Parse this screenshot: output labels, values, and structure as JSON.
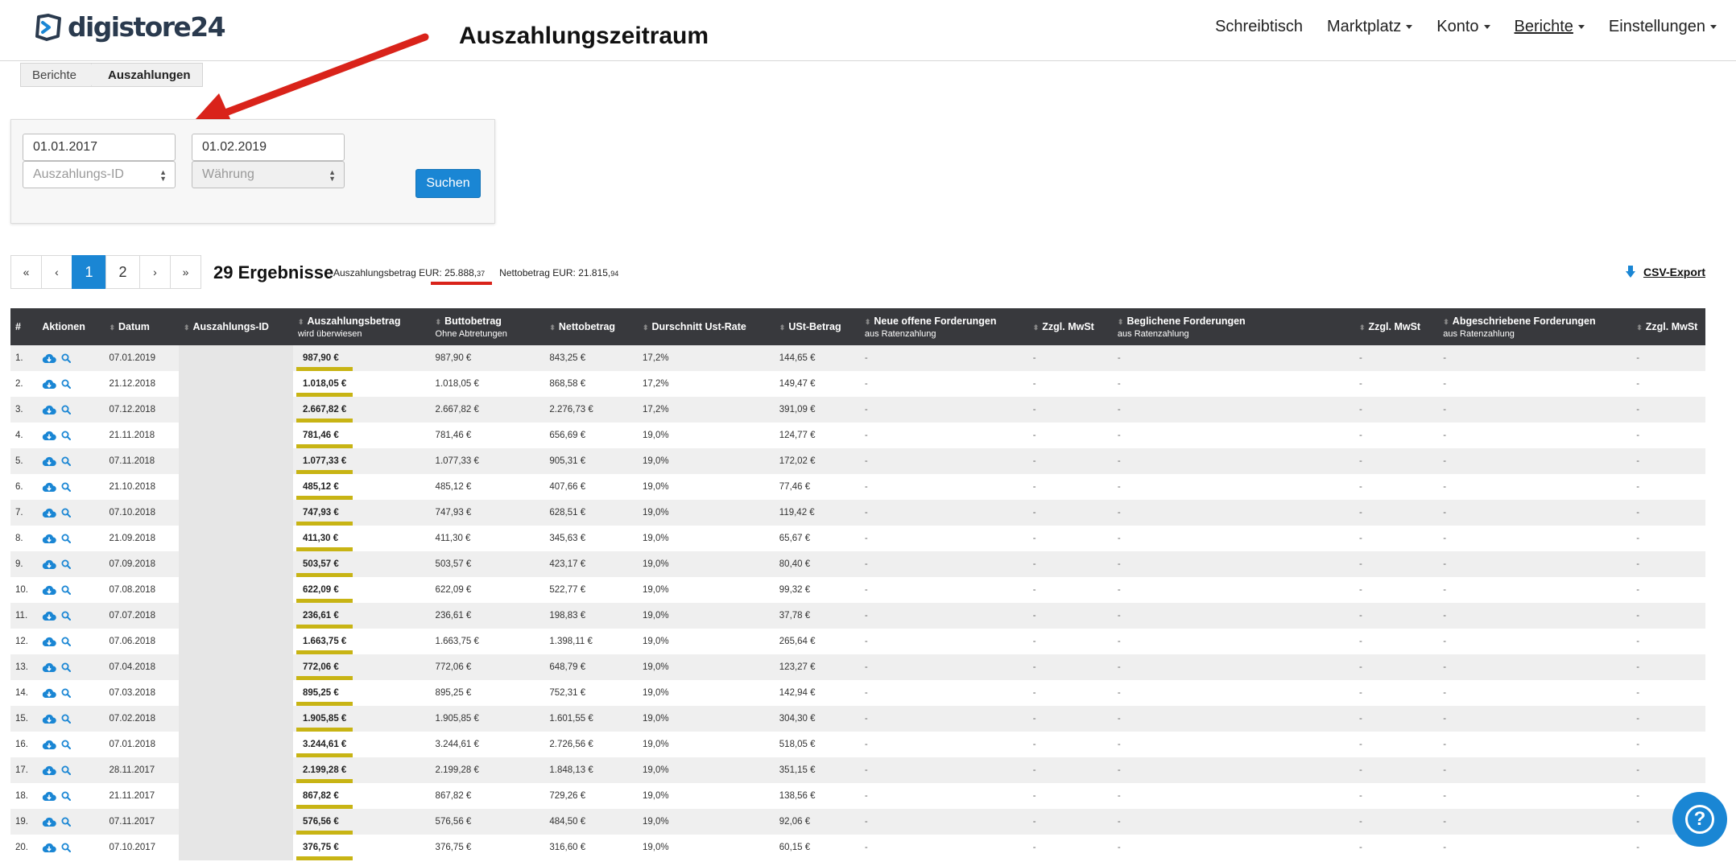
{
  "brand": {
    "name": "digistore24",
    "color": "#2a3a4e"
  },
  "nav": {
    "items": [
      {
        "label": "Schreibtisch"
      },
      {
        "label": "Marktplatz"
      },
      {
        "label": "Konto"
      },
      {
        "label": "Berichte",
        "active": true
      },
      {
        "label": "Einstellungen"
      }
    ]
  },
  "annotation": {
    "title": "Auszahlungszeitraum",
    "arrow_color": "#d9231a"
  },
  "breadcrumb": {
    "parent": "Berichte",
    "current": "Auszahlungen"
  },
  "filter": {
    "date_from": "01.01.2017",
    "date_to": "01.02.2019",
    "payout_id_placeholder": "Auszahlungs-ID",
    "currency_placeholder": "Währung",
    "search_label": "Suchen"
  },
  "pagination": {
    "first": "«",
    "prev": "‹",
    "pages": [
      "1",
      "2"
    ],
    "current": "1",
    "next": "›",
    "last": "»"
  },
  "summary": {
    "results": "29 Ergebnisse",
    "payout_label": "Auszahlungsbetrag EUR:",
    "payout_main": "25.888,",
    "payout_cents": "37",
    "net_label": "Nettobetrag EUR:",
    "net_main": "21.815,",
    "net_cents": "94",
    "csv_label": "CSV-Export"
  },
  "table": {
    "headers": [
      {
        "label": "#",
        "sort": false
      },
      {
        "label": "Aktionen",
        "sort": false
      },
      {
        "label": "Datum",
        "sort": true
      },
      {
        "label": "Auszahlungs-ID",
        "sort": true
      },
      {
        "label": "Auszahlungsbetrag",
        "sub": "wird überwiesen",
        "sort": true
      },
      {
        "label": "Buttobetrag",
        "sub": "Ohne Abtretungen",
        "sort": true
      },
      {
        "label": "Nettobetrag",
        "sort": true
      },
      {
        "label": "Durschnitt Ust-Rate",
        "sort": true
      },
      {
        "label": "USt-Betrag",
        "sort": true
      },
      {
        "label": "Neue offene Forderungen",
        "sub": "aus Ratenzahlung",
        "sort": true
      },
      {
        "label": "Zzgl. MwSt",
        "sort": true
      },
      {
        "label": "Beglichene Forderungen",
        "sub": "aus Ratenzahlung",
        "sort": true
      },
      {
        "label": "Zzgl. MwSt",
        "sort": true
      },
      {
        "label": "Abgeschriebene Forderungen",
        "sub": "aus Ratenzahlung",
        "sort": true
      },
      {
        "label": "Zzgl. MwSt",
        "sort": true
      }
    ],
    "rows": [
      [
        "1.",
        "07.01.2019",
        "987,90 €",
        "987,90 €",
        "843,25 €",
        "17,2%",
        "144,65 €"
      ],
      [
        "2.",
        "21.12.2018",
        "1.018,05 €",
        "1.018,05 €",
        "868,58 €",
        "17,2%",
        "149,47 €"
      ],
      [
        "3.",
        "07.12.2018",
        "2.667,82 €",
        "2.667,82 €",
        "2.276,73 €",
        "17,2%",
        "391,09 €"
      ],
      [
        "4.",
        "21.11.2018",
        "781,46 €",
        "781,46 €",
        "656,69 €",
        "19,0%",
        "124,77 €"
      ],
      [
        "5.",
        "07.11.2018",
        "1.077,33 €",
        "1.077,33 €",
        "905,31 €",
        "19,0%",
        "172,02 €"
      ],
      [
        "6.",
        "21.10.2018",
        "485,12 €",
        "485,12 €",
        "407,66 €",
        "19,0%",
        "77,46 €"
      ],
      [
        "7.",
        "07.10.2018",
        "747,93 €",
        "747,93 €",
        "628,51 €",
        "19,0%",
        "119,42 €"
      ],
      [
        "8.",
        "21.09.2018",
        "411,30 €",
        "411,30 €",
        "345,63 €",
        "19,0%",
        "65,67 €"
      ],
      [
        "9.",
        "07.09.2018",
        "503,57 €",
        "503,57 €",
        "423,17 €",
        "19,0%",
        "80,40 €"
      ],
      [
        "10.",
        "07.08.2018",
        "622,09 €",
        "622,09 €",
        "522,77 €",
        "19,0%",
        "99,32 €"
      ],
      [
        "11.",
        "07.07.2018",
        "236,61 €",
        "236,61 €",
        "198,83 €",
        "19,0%",
        "37,78 €"
      ],
      [
        "12.",
        "07.06.2018",
        "1.663,75 €",
        "1.663,75 €",
        "1.398,11 €",
        "19,0%",
        "265,64 €"
      ],
      [
        "13.",
        "07.04.2018",
        "772,06 €",
        "772,06 €",
        "648,79 €",
        "19,0%",
        "123,27 €"
      ],
      [
        "14.",
        "07.03.2018",
        "895,25 €",
        "895,25 €",
        "752,31 €",
        "19,0%",
        "142,94 €"
      ],
      [
        "15.",
        "07.02.2018",
        "1.905,85 €",
        "1.905,85 €",
        "1.601,55 €",
        "19,0%",
        "304,30 €"
      ],
      [
        "16.",
        "07.01.2018",
        "3.244,61 €",
        "3.244,61 €",
        "2.726,56 €",
        "19,0%",
        "518,05 €"
      ],
      [
        "17.",
        "28.11.2017",
        "2.199,28 €",
        "2.199,28 €",
        "1.848,13 €",
        "19,0%",
        "351,15 €"
      ],
      [
        "18.",
        "21.11.2017",
        "867,82 €",
        "867,82 €",
        "729,26 €",
        "19,0%",
        "138,56 €"
      ],
      [
        "19.",
        "07.11.2017",
        "576,56 €",
        "576,56 €",
        "484,50 €",
        "19,0%",
        "92,06 €"
      ],
      [
        "20.",
        "07.10.2017",
        "376,75 €",
        "376,75 €",
        "316,60 €",
        "19,0%",
        "60,15 €"
      ]
    ],
    "empty_value": "-",
    "highlight_color": "#c8b414"
  },
  "help": {
    "label": "?"
  }
}
